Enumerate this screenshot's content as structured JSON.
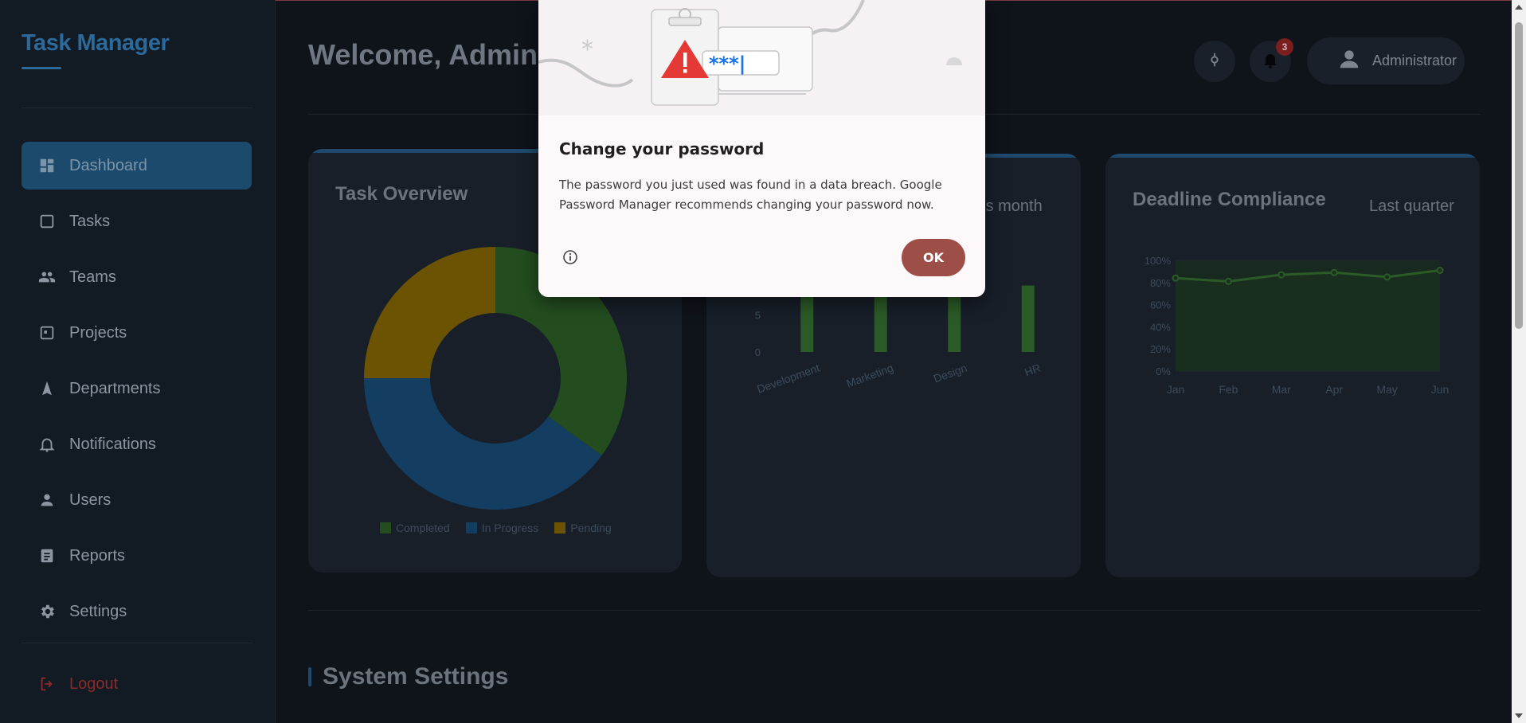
{
  "brand": "Task Manager",
  "nav": [
    {
      "label": "Dashboard",
      "icon": "dashboard-icon",
      "active": true
    },
    {
      "label": "Tasks",
      "icon": "checkbox-icon"
    },
    {
      "label": "Teams",
      "icon": "people-icon"
    },
    {
      "label": "Projects",
      "icon": "project-icon"
    },
    {
      "label": "Departments",
      "icon": "navigation-arrow-icon"
    },
    {
      "label": "Notifications",
      "icon": "bell-icon"
    },
    {
      "label": "Users",
      "icon": "user-icon"
    },
    {
      "label": "Reports",
      "icon": "report-icon"
    },
    {
      "label": "Settings",
      "icon": "gear-icon"
    }
  ],
  "logout": "Logout",
  "header": {
    "welcome": "Welcome, Adminis",
    "notification_count": "3",
    "user_name": "Administrator"
  },
  "cards": {
    "task_overview": {
      "title": "Task Overview"
    },
    "department": {
      "subtitle": "his month"
    },
    "deadline": {
      "title": "Deadline Compliance",
      "subtitle": "Last quarter"
    }
  },
  "chart_data": [
    {
      "type": "pie",
      "categories": [
        "Completed",
        "In Progress",
        "Pending"
      ],
      "values": [
        35,
        40,
        25
      ],
      "colors": [
        "#234d1f",
        "#133e61",
        "#6b5303"
      ],
      "legend": "bottom"
    },
    {
      "type": "bar",
      "categories": [
        "Development",
        "Marketing",
        "Design",
        "HR"
      ],
      "values": [
        14,
        14,
        13,
        9
      ],
      "yticks": [
        0,
        5,
        10
      ],
      "ylim": [
        0,
        15
      ],
      "color": "#2b5b27"
    },
    {
      "type": "line",
      "categories": [
        "Jan",
        "Feb",
        "Mar",
        "Apr",
        "May",
        "Jun"
      ],
      "values": [
        84,
        81,
        87,
        89,
        85,
        91
      ],
      "yticks": [
        "0%",
        "20%",
        "40%",
        "60%",
        "80%",
        "100%"
      ],
      "ylim": [
        0,
        100
      ],
      "color": "#2b5b27"
    }
  ],
  "section": {
    "title": "System Settings"
  },
  "dialog": {
    "title": "Change your password",
    "body": "The password you just used was found in a data breach. Google Password Manager recommends changing your password now.",
    "ok": "OK",
    "password_mask": "***|"
  }
}
